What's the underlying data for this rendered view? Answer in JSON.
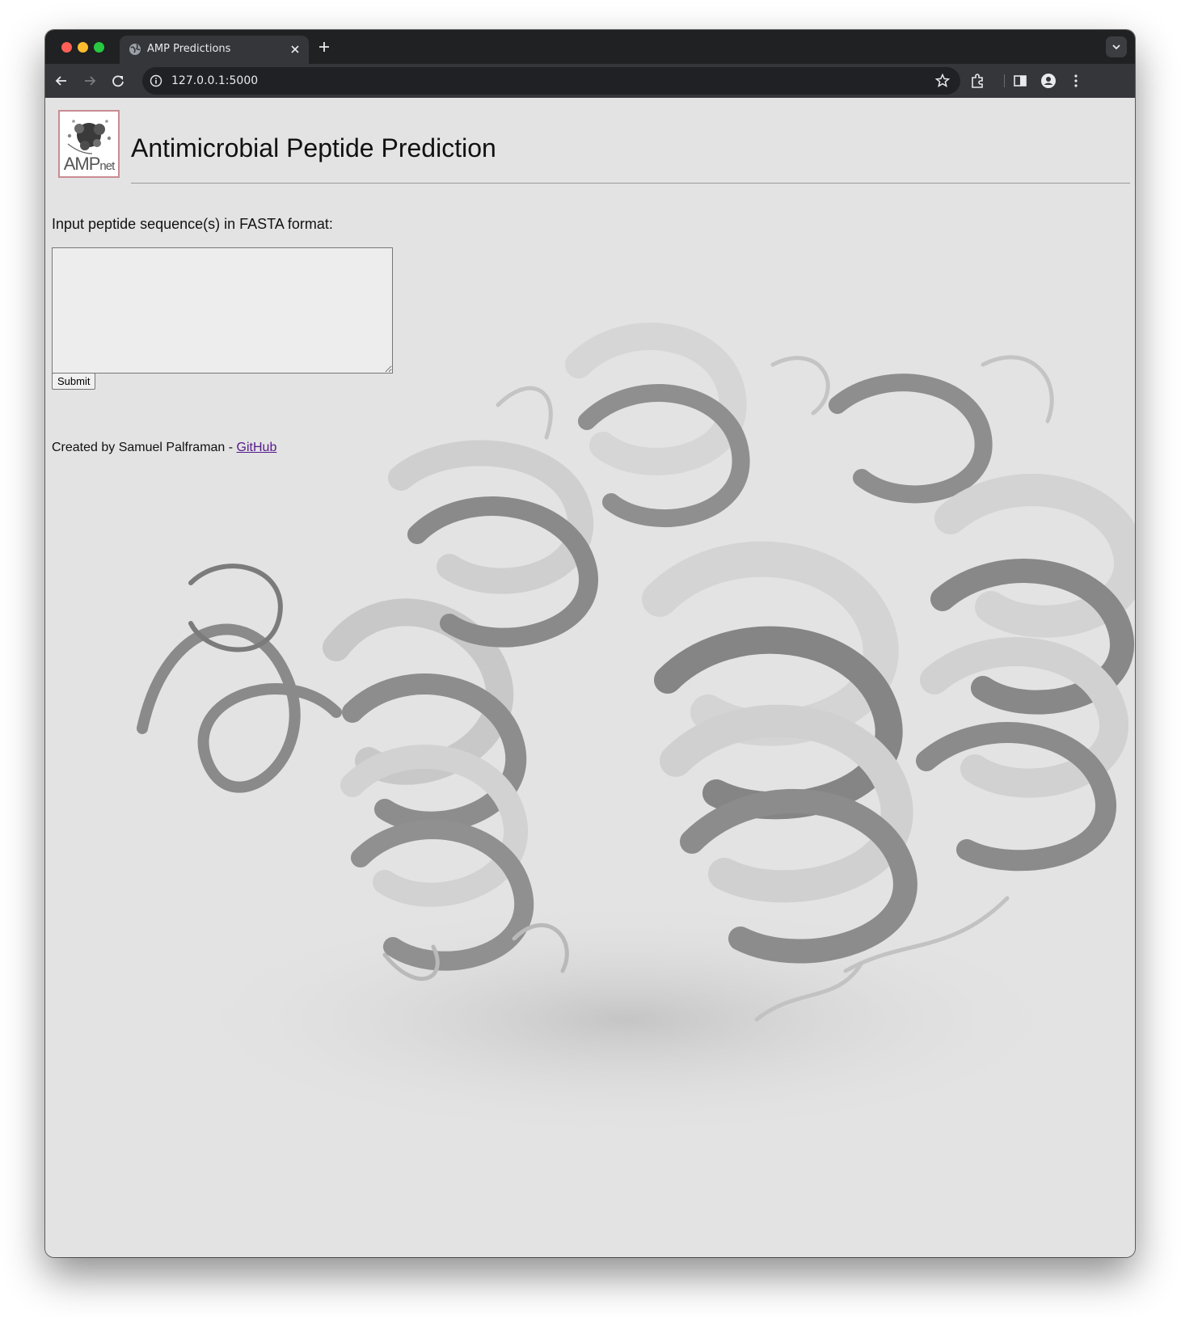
{
  "browser": {
    "tab_title": "AMP Predictions",
    "url": "127.0.0.1:5000",
    "icons": [
      "globe-icon",
      "close-icon",
      "plus-icon",
      "chevron-down-icon",
      "back-arrow-icon",
      "forward-arrow-icon",
      "reload-icon",
      "info-icon",
      "star-icon",
      "extensions-icon",
      "side-panel-icon",
      "profile-icon",
      "more-menu-icon"
    ],
    "colors": {
      "tab_strip": "#1f2122",
      "toolbar": "#35363a",
      "omnibox": "#202124"
    }
  },
  "header": {
    "logo_text": "AMP",
    "logo_suffix": "net",
    "title": "Antimicrobial Peptide Prediction"
  },
  "form": {
    "label": "Input peptide sequence(s) in FASTA format:",
    "textarea_value": "",
    "submit_label": "Submit"
  },
  "footer": {
    "text": "Created by Samuel Palframan - ",
    "link_text": "GitHub",
    "link_color": "#551a8b"
  },
  "background": {
    "description_icon": "protein-ribbon-background"
  }
}
